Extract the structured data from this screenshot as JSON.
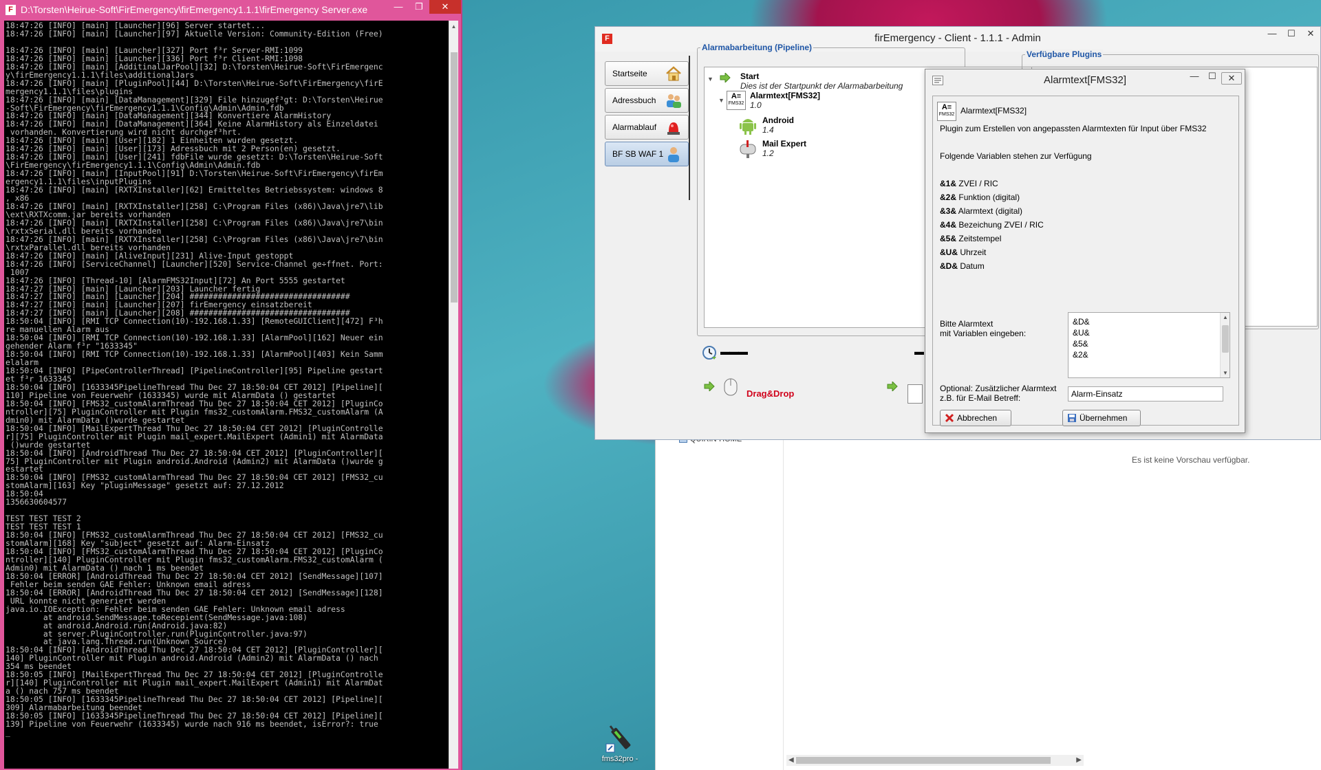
{
  "console": {
    "title": "D:\\Torsten\\Heirue-Soft\\FirEmergency\\firEmergency1.1.1\\firEmergency Server.exe",
    "log": "18:47:26 [INFO] [main] [Launcher][96] Server startet...\n18:47:26 [INFO] [main] [Launcher][97] Aktuelle Version: Community-Edition (Free)\n\n18:47:26 [INFO] [main] [Launcher][327] Port f³r Server-RMI:1099\n18:47:26 [INFO] [main] [Launcher][336] Port f³r Client-RMI:1098\n18:47:26 [INFO] [main] [AdditinalJarPool][32] D:\\Torsten\\Heirue-Soft\\FirEmergenc\ny\\firEmergency1.1.1\\files\\additionalJars\n18:47:26 [INFO] [main] [PluginPool][44] D:\\Torsten\\Heirue-Soft\\FirEmergency\\firE\nmergency1.1.1\\files\\plugins\n18:47:26 [INFO] [main] [DataManagement][329] File hinzugef³gt: D:\\Torsten\\Heirue\n-Soft\\FirEmergency\\firEmergency1.1.1\\Config\\Admin\\Admin.fdb\n18:47:26 [INFO] [main] [DataManagement][344] Konvertiere AlarmHistory\n18:47:26 [INFO] [main] [DataManagement][364] Keine AlarmHistory als Einzeldatei\n vorhanden. Konvertierung wird nicht durchgef³hrt.\n18:47:26 [INFO] [main] [User][182] 1 Einheiten wurden gesetzt.\n18:47:26 [INFO] [main] [User][173] Adressbuch mit 2 Person(en) gesetzt.\n18:47:26 [INFO] [main] [User][241] fdbFile wurde gesetzt: D:\\Torsten\\Heirue-Soft\n\\FirEmergency\\firEmergency1.1.1\\Config\\Admin\\Admin.fdb\n18:47:26 [INFO] [main] [InputPool][91] D:\\Torsten\\Heirue-Soft\\FirEmergency\\firEm\nergency1.1.1\\files\\inputPlugins\n18:47:26 [INFO] [main] [RXTXInstaller][62] Ermitteltes Betriebssystem: windows 8\n, x86\n18:47:26 [INFO] [main] [RXTXInstaller][258] C:\\Program Files (x86)\\Java\\jre7\\lib\n\\ext\\RXTXcomm.jar bereits vorhanden\n18:47:26 [INFO] [main] [RXTXInstaller][258] C:\\Program Files (x86)\\Java\\jre7\\bin\n\\rxtxSerial.dll bereits vorhanden\n18:47:26 [INFO] [main] [RXTXInstaller][258] C:\\Program Files (x86)\\Java\\jre7\\bin\n\\rxtxParallel.dll bereits vorhanden\n18:47:26 [INFO] [main] [AliveInput][231] Alive-Input gestoppt\n18:47:26 [INFO] [ServiceChannel] [Launcher][520] Service-Channel ge÷ffnet. Port:\n 1007\n18:47:26 [INFO] [Thread-10] [AlarmFMS32Input][72] An Port 5555 gestartet\n18:47:27 [INFO] [main] [Launcher][203] Launcher fertig\n18:47:27 [INFO] [main] [Launcher][204] ##################################\n18:47:27 [INFO] [main] [Launcher][207] firEmergency einsatzbereit\n18:47:27 [INFO] [main] [Launcher][208] ##################################\n18:50:04 [INFO] [RMI TCP Connection(10)-192.168.1.33] [RemoteGUIClient][472] F³h\nre manuellen Alarm aus\n18:50:04 [INFO] [RMI TCP Connection(10)-192.168.1.33] [AlarmPool][162] Neuer ein\ngehender Alarm f³r \"1633345\"\n18:50:04 [INFO] [RMI TCP Connection(10)-192.168.1.33] [AlarmPool][403] Kein Samm\nelalarm\n18:50:04 [INFO] [PipeControllerThread] [PipelineController][95] Pipeline gestart\net f³r 1633345\n18:50:04 [INFO] [1633345PipelineThread Thu Dec 27 18:50:04 CET 2012] [Pipeline][\n110] Pipeline von Feuerwehr (1633345) wurde mit AlarmData () gestartet\n18:50:04 [INFO] [FMS32_customAlarmThread Thu Dec 27 18:50:04 CET 2012] [PluginCo\nntroller][75] PluginController mit Plugin fms32_customAlarm.FMS32_customAlarm (A\ndmin0) mit AlarmData ()wurde gestartet\n18:50:04 [INFO] [MailExpertThread Thu Dec 27 18:50:04 CET 2012] [PluginControlle\nr][75] PluginController mit Plugin mail_expert.MailExpert (Admin1) mit AlarmData\n ()wurde gestartet\n18:50:04 [INFO] [AndroidThread Thu Dec 27 18:50:04 CET 2012] [PluginController][\n75] PluginController mit Plugin android.Android (Admin2) mit AlarmData ()wurde g\nestartet\n18:50:04 [INFO] [FMS32_customAlarmThread Thu Dec 27 18:50:04 CET 2012] [FMS32_cu\nstomAlarm][163] Key \"pluginMessage\" gesetzt auf: 27.12.2012\n18:50:04\n1356630604577\n\nTEST TEST TEST 2\nTEST TEST TEST 1\n18:50:04 [INFO] [FMS32_customAlarmThread Thu Dec 27 18:50:04 CET 2012] [FMS32_cu\nstomAlarm][168] Key \"subject\" gesetzt auf: Alarm-Einsatz\n18:50:04 [INFO] [FMS32_customAlarmThread Thu Dec 27 18:50:04 CET 2012] [PluginCo\nntroller][140] PluginController mit Plugin fms32_customAlarm.FMS32_customAlarm (\nAdmin0) mit AlarmData () nach 1 ms beendet\n18:50:04 [ERROR] [AndroidThread Thu Dec 27 18:50:04 CET 2012] [SendMessage][107]\n Fehler beim senden GAE Fehler: Unknown email adress\n18:50:04 [ERROR] [AndroidThread Thu Dec 27 18:50:04 CET 2012] [SendMessage][128]\n URL konnte nicht generiert werden\njava.io.IOException: Fehler beim senden GAE Fehler: Unknown email adress\n        at android.SendMessage.toRecepient(SendMessage.java:108)\n        at android.Android.run(Android.java:82)\n        at server.PluginController.run(PluginController.java:97)\n        at java.lang.Thread.run(Unknown Source)\n18:50:04 [INFO] [AndroidThread Thu Dec 27 18:50:04 CET 2012] [PluginController][\n140] PluginController mit Plugin android.Android (Admin2) mit AlarmData () nach\n354 ms beendet\n18:50:05 [INFO] [MailExpertThread Thu Dec 27 18:50:04 CET 2012] [PluginControlle\nr][140] PluginController mit Plugin mail_expert.MailExpert (Admin1) mit AlarmDat\na () nach 757 ms beendet\n18:50:05 [INFO] [1633345PipelineThread Thu Dec 27 18:50:04 CET 2012] [Pipeline][\n309] Alarmabarbeitung beendet\n18:50:05 [INFO] [1633345PipelineThread Thu Dec 27 18:50:04 CET 2012] [Pipeline][\n139] Pipeline von Feuerwehr (1633345) wurde nach 916 ms beendet, isError?: true\n_"
  },
  "client": {
    "title": "firEmergency - Client - 1.1.1 - Admin",
    "nav": [
      {
        "label": "Startseite"
      },
      {
        "label": "Adressbuch"
      },
      {
        "label": "Alarmablauf"
      },
      {
        "label": "BF SB WAF 1"
      }
    ],
    "pipeline_legend": "Alarmabarbeitung (Pipeline)",
    "plugins_legend": "Verfügbare Plugins",
    "tree": {
      "start_title": "Start",
      "start_sub": "Dies ist der Startpunkt der Alarmabarbeitung",
      "alarmtext_title": "Alarmtext[FMS32]",
      "alarmtext_version": "1.0",
      "alarmtext_icon_label": "FMS32",
      "android_title": "Android",
      "android_version": "1.4",
      "mail_title": "Mail Expert",
      "mail_version": "1.2"
    },
    "drag_label": "Drag&Drop",
    "dash_label": "▬▬▬",
    "dash_right": "▬"
  },
  "dialog": {
    "title": "Alarmtext[FMS32]",
    "header_name": "Alarmtext[FMS32]",
    "header_icon_label": "FMS32",
    "description": "Plugin zum Erstellen von angepassten Alarmtexten für Input über FMS32",
    "vars_intro": "Folgende Variablen stehen zur Verfügung",
    "variables": [
      {
        "code": "&1&",
        "desc": "ZVEI / RIC"
      },
      {
        "code": "&2&",
        "desc": "Funktion (digital)"
      },
      {
        "code": "&3&",
        "desc": "Alarmtext (digital)"
      },
      {
        "code": "&4&",
        "desc": "Bezeichung ZVEI / RIC"
      },
      {
        "code": "&5&",
        "desc": "Zeitstempel"
      },
      {
        "code": "&U&",
        "desc": "Uhrzeit"
      },
      {
        "code": "&D&",
        "desc": "Datum"
      }
    ],
    "textarea_label_1": "Bitte Alarmtext",
    "textarea_label_2": "mit Variablen eingeben:",
    "textarea_lines": [
      "&D&",
      "&U&",
      "&5&",
      "",
      "&2&"
    ],
    "subject_label_1": "Optional: Zusätzlicher Alarmtext",
    "subject_label_2": "z.B. für E-Mail Betreff:",
    "subject_value": "Alarm-Einsatz",
    "cancel_label": "Abbrechen",
    "apply_label": "Übernehmen"
  },
  "explorer": {
    "nav_item": "QUIRIN-HOME",
    "preview_text": "Es ist keine Vorschau verfügbar."
  },
  "desktop": {
    "icon_label": "fms32pro -"
  },
  "colors": {
    "console_frame": "#e0569b",
    "legend_blue": "#1f56a6",
    "drag_red": "#d0021b"
  }
}
